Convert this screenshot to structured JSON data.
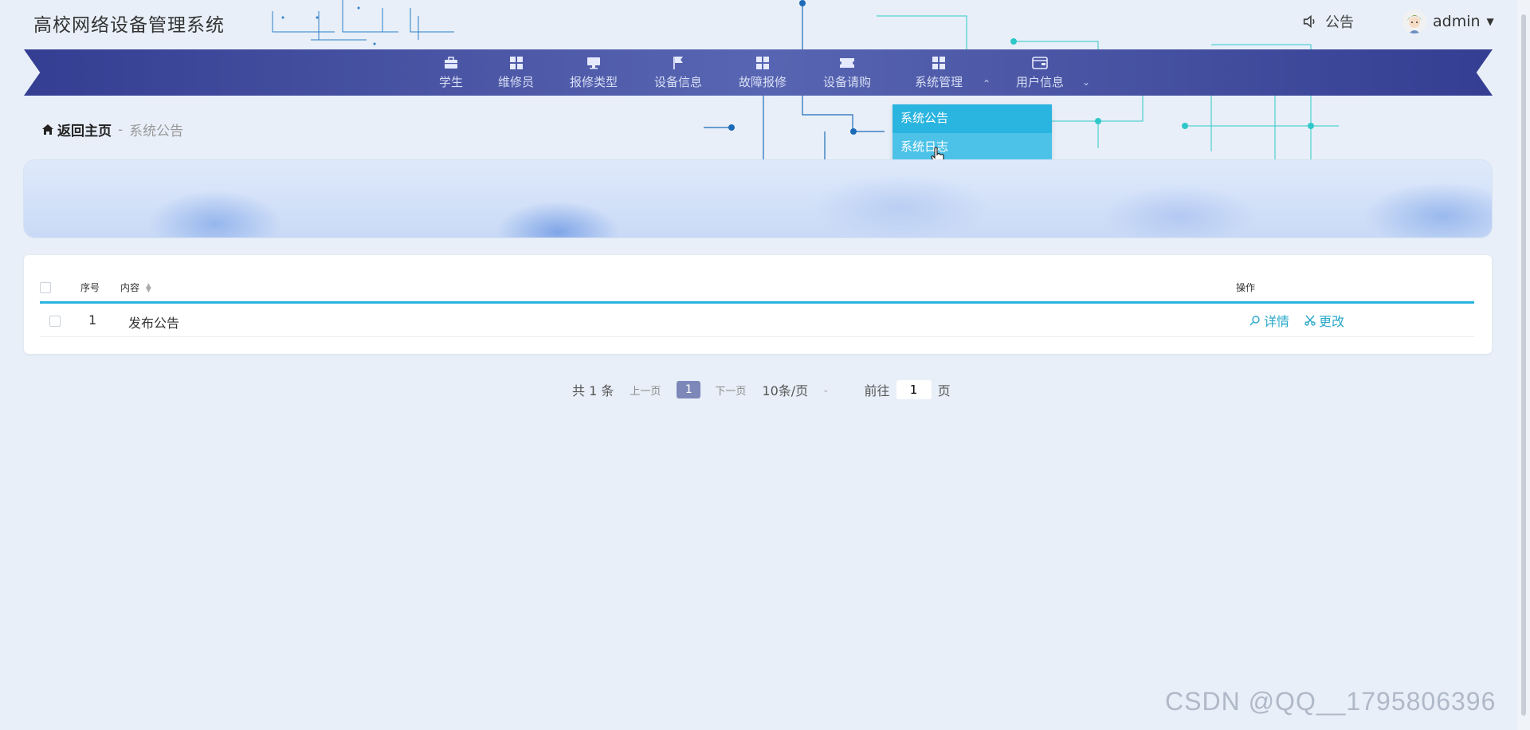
{
  "header": {
    "title": "高校网络设备管理系统",
    "notice_label": "公告",
    "user_name": "admin"
  },
  "nav": {
    "items": [
      {
        "label": "学生",
        "icon": "briefcase-icon"
      },
      {
        "label": "维修员",
        "icon": "grid-icon"
      },
      {
        "label": "报修类型",
        "icon": "monitor-icon"
      },
      {
        "label": "设备信息",
        "icon": "flag-icon"
      },
      {
        "label": "故障报修",
        "icon": "grid-icon"
      },
      {
        "label": "设备请购",
        "icon": "ticket-icon"
      },
      {
        "label": "系统管理",
        "icon": "grid-icon"
      },
      {
        "label": "用户信息",
        "icon": "wallet-icon"
      }
    ],
    "dropdown": [
      "系统公告",
      "系统日志"
    ]
  },
  "breadcrumb": {
    "home": "返回主页",
    "separator": "-",
    "current": "系统公告"
  },
  "table": {
    "headers": {
      "index": "序号",
      "content": "内容",
      "actions": "操作"
    },
    "rows": [
      {
        "index": "1",
        "content": "发布公告",
        "detail": "详情",
        "edit": "更改"
      }
    ]
  },
  "pagination": {
    "total": "共 1 条",
    "prev": "上一页",
    "current_page": "1",
    "next": "下一页",
    "page_size": "10条/页",
    "goto_label": "前往",
    "goto_value": "1",
    "page_suffix": "页"
  },
  "watermark": "CSDN @QQ__1795806396",
  "colors": {
    "nav_dark": "#343e92",
    "nav_mid": "#5765b2",
    "accent": "#2ab4e0",
    "page_bg": "#e8eff8"
  }
}
